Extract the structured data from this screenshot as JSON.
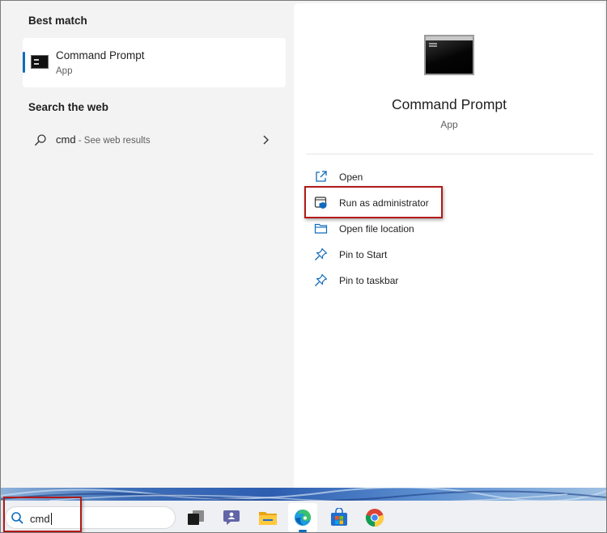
{
  "left_pane": {
    "best_match_title": "Best match",
    "best_match": {
      "name": "Command Prompt",
      "type": "App",
      "icon": "command-prompt-icon"
    },
    "web_title": "Search the web",
    "web_result": {
      "query": "cmd",
      "hint": " - See web results"
    }
  },
  "right_pane": {
    "title": "Command Prompt",
    "subtitle": "App",
    "actions": [
      {
        "label": "Open",
        "icon": "open-external-icon"
      },
      {
        "label": "Run as administrator",
        "icon": "shield-admin-icon"
      },
      {
        "label": "Open file location",
        "icon": "folder-icon"
      },
      {
        "label": "Pin to Start",
        "icon": "pin-icon"
      },
      {
        "label": "Pin to taskbar",
        "icon": "pin-icon"
      }
    ]
  },
  "taskbar": {
    "search_value": "cmd",
    "apps": [
      "task-view-icon",
      "chat-icon",
      "file-explorer-icon",
      "edge-icon",
      "store-icon",
      "chrome-icon"
    ]
  },
  "colors": {
    "accent": "#0f6cbd",
    "highlight": "#b11a1a"
  }
}
